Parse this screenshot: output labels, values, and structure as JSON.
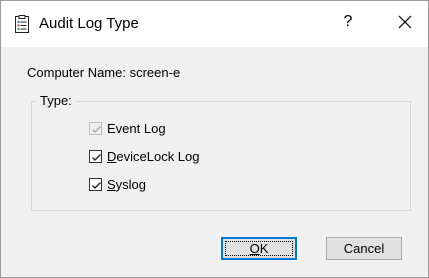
{
  "window": {
    "title": "Audit Log Type",
    "help_label": "?",
    "close_icon": "close-icon"
  },
  "computer_name": "Computer Name: screen-e",
  "type_group": {
    "label": "Type:",
    "options": [
      {
        "pre": "",
        "mnemonic": "",
        "post": "Event Log",
        "checked": true,
        "disabled": true
      },
      {
        "pre": "",
        "mnemonic": "D",
        "post": "eviceLock Log",
        "checked": true,
        "disabled": false
      },
      {
        "pre": "",
        "mnemonic": "S",
        "post": "yslog",
        "checked": true,
        "disabled": false
      }
    ]
  },
  "buttons": {
    "ok": {
      "pre": "",
      "mnemonic": "O",
      "post": "K"
    },
    "cancel": "Cancel"
  },
  "colors": {
    "focus_border": "#0078d7",
    "dialog_bg": "#f0f0f0"
  }
}
